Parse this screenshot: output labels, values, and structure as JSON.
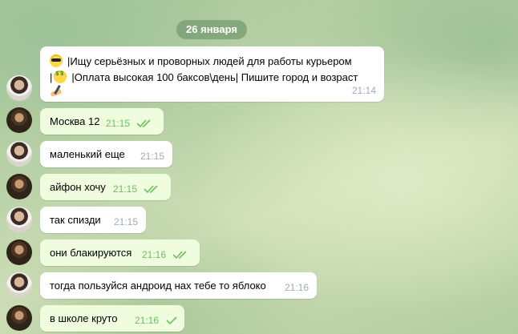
{
  "date_divider": "26 января",
  "messages": [
    {
      "direction": "in",
      "lines": [
        "|Ищу серьёзных и проворных людей для работы курьером",
        "|Оплата высокая 100 баксов\\день| Пишите город и возраст"
      ],
      "emojis": [
        "smiling-face-with-sunglasses",
        "money-mouth-face",
        "writing-hand"
      ],
      "time": "21:14"
    },
    {
      "direction": "out",
      "text": "Москва 12",
      "time": "21:15",
      "status": "read"
    },
    {
      "direction": "in",
      "text": "маленький еще",
      "time": "21:15"
    },
    {
      "direction": "out",
      "text": "айфон хочу",
      "time": "21:15",
      "status": "read"
    },
    {
      "direction": "in",
      "text": "так спизди",
      "time": "21:15"
    },
    {
      "direction": "out",
      "text": "они блакируются",
      "time": "21:16",
      "status": "read"
    },
    {
      "direction": "in",
      "text": "тогда пользуйся андроид нах тебе то яблоко",
      "time": "21:16"
    },
    {
      "direction": "out",
      "text": "в школе круто",
      "time": "21:16",
      "status": "sent"
    }
  ],
  "colors": {
    "incoming_bubble": "#ffffff",
    "outgoing_bubble": "#effdde",
    "outgoing_time": "#6cbf62",
    "incoming_time": "#a0acb6",
    "date_pill": "#628a60"
  }
}
